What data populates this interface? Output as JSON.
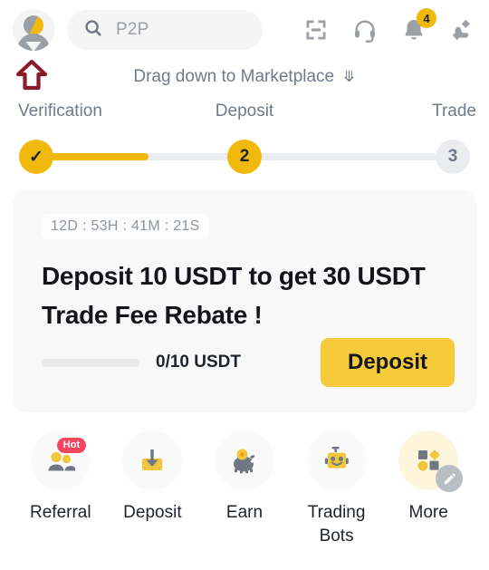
{
  "header": {
    "avatar_name": "user-avatar",
    "search": {
      "placeholder": "P2P",
      "icon": "search-icon"
    },
    "icons": [
      {
        "name": "scan-icon",
        "label": "Scan"
      },
      {
        "name": "headset-icon",
        "label": "Support"
      },
      {
        "name": "bell-icon",
        "label": "Notifications",
        "badge": "4"
      },
      {
        "name": "hand-diamond-icon",
        "label": "Rewards"
      }
    ]
  },
  "drag_hint": {
    "text": "Drag down to Marketplace",
    "chevron": "»"
  },
  "stepper": {
    "steps": [
      {
        "label": "Verification",
        "marker": "✓",
        "state": "complete"
      },
      {
        "label": "Deposit",
        "marker": "2",
        "state": "active"
      },
      {
        "label": "Trade",
        "marker": "3",
        "state": "pending"
      }
    ],
    "progress_percent": 27,
    "accent_color": "#f0b90b",
    "track_color": "#eaecef"
  },
  "promo": {
    "timer": "12D : 53H : 41M : 21S",
    "title": "Deposit 10 USDT to get 30 USDT Trade Fee Rebate !",
    "progress_label": "0/10 USDT",
    "progress_percent": 0,
    "button_label": "Deposit",
    "button_color": "#f5cb3a"
  },
  "quick_actions": [
    {
      "label": "Referral",
      "icon": "referral-people-icon",
      "badge": "Hot"
    },
    {
      "label": "Deposit",
      "icon": "deposit-arrow-icon",
      "badge": null
    },
    {
      "label": "Earn",
      "icon": "piggy-bank-icon",
      "badge": null
    },
    {
      "label": "Trading Bots",
      "icon": "robot-icon",
      "badge": null
    },
    {
      "label": "More",
      "icon": "more-shapes-icon",
      "badge": "edit-icon"
    }
  ],
  "annotation": {
    "name": "red-up-arrow",
    "color": "#8b1a2b"
  }
}
